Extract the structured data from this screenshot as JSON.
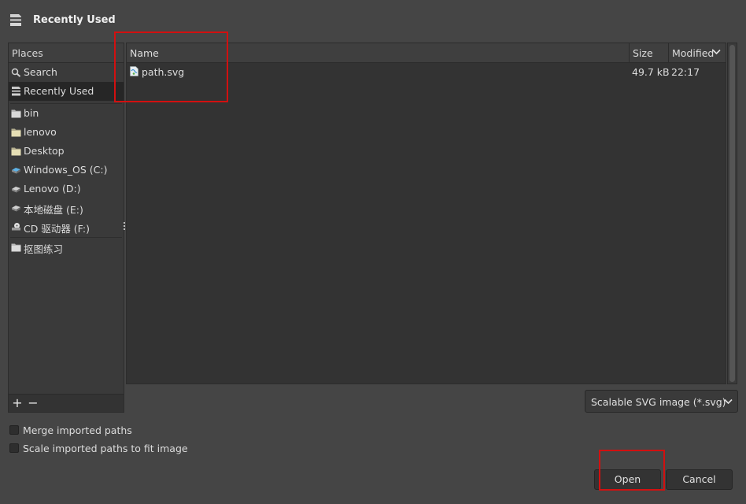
{
  "dialog": {
    "title": "Recently Used",
    "title_icon": "recent-stack-icon"
  },
  "places": {
    "header": "Places",
    "items": [
      {
        "label": "Search",
        "icon": "search-icon"
      },
      {
        "label": "Recently Used",
        "icon": "recent-icon",
        "selected": true
      },
      {
        "label": "bin",
        "icon": "folder-icon"
      },
      {
        "label": "lenovo",
        "icon": "folder-icon"
      },
      {
        "label": "Desktop",
        "icon": "folder-icon"
      },
      {
        "label": "Windows_OS (C:)",
        "icon": "drive-icon"
      },
      {
        "label": "Lenovo (D:)",
        "icon": "drive-icon"
      },
      {
        "label": "本地磁盘 (E:)",
        "icon": "drive-icon"
      },
      {
        "label": "CD 驱动器 (F:)",
        "icon": "cd-drive-icon"
      },
      {
        "label": "抠图练习",
        "icon": "folder-icon"
      }
    ],
    "add_label": "+",
    "remove_label": "−"
  },
  "files": {
    "columns": {
      "name": "Name",
      "size": "Size",
      "modified": "Modified"
    },
    "sort": "descending",
    "rows": [
      {
        "name": "path.svg",
        "size": "49.7 kB",
        "modified": "22:17",
        "icon": "svg-file-icon"
      }
    ]
  },
  "filter": {
    "selected": "Scalable SVG image (*.svg)"
  },
  "options": {
    "merge_paths": {
      "label": "Merge imported paths",
      "checked": false
    },
    "scale_paths": {
      "label": "Scale imported paths to fit image",
      "checked": false
    }
  },
  "buttons": {
    "open": "Open",
    "cancel": "Cancel"
  },
  "colors": {
    "annotation": "#d21010",
    "background": "#454545",
    "selection": "#262626"
  }
}
